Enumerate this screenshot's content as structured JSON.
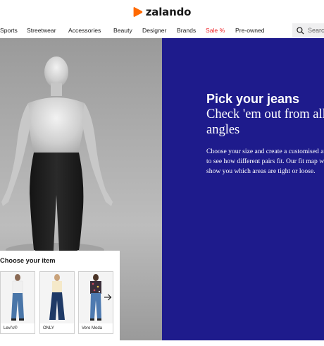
{
  "brand": {
    "name": "zalando",
    "accent": "#ff6900"
  },
  "nav": {
    "items": [
      {
        "label": "Sports"
      },
      {
        "label": "Streetwear"
      },
      {
        "label": "Accessories"
      },
      {
        "label": "Beauty"
      },
      {
        "label": "Designer"
      },
      {
        "label": "Brands"
      },
      {
        "label": "Sale %",
        "color": "#ee1d23"
      },
      {
        "label": "Pre-owned"
      }
    ]
  },
  "search": {
    "placeholder": "Search",
    "icon": "search-icon"
  },
  "hero": {
    "title": "Pick your jeans",
    "subtitle": "Check 'em out from all angles",
    "body": "Choose your size and create a customised avatar to see how different pairs fit. Our fit map will show you which areas are tight or loose.",
    "background": "#1e1b8c"
  },
  "chooser": {
    "title": "Choose your item",
    "items": [
      {
        "brand": "Levi's®",
        "jeans_color": "#4a76a8"
      },
      {
        "brand": "ONLY",
        "jeans_color": "#1f3a66"
      },
      {
        "brand": "Vero Moda",
        "jeans_color": "#4e7ab0"
      }
    ],
    "next_icon": "arrow-right-icon"
  }
}
